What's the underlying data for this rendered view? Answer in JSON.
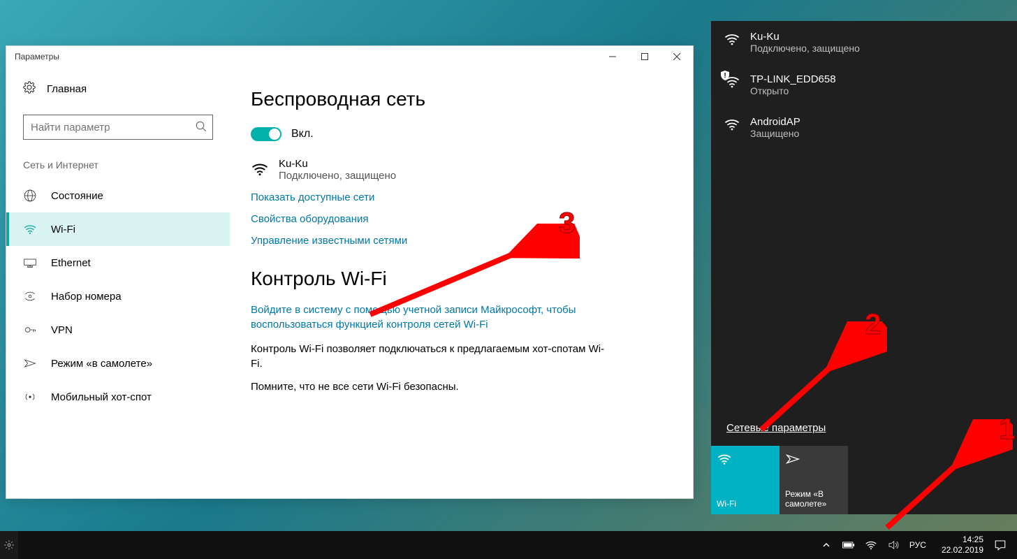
{
  "settings_window": {
    "title": "Параметры",
    "home": "Главная",
    "search_placeholder": "Найти параметр",
    "category": "Сеть и Интернет",
    "nav": [
      {
        "icon": "status",
        "label": "Состояние"
      },
      {
        "icon": "wifi",
        "label": "Wi-Fi"
      },
      {
        "icon": "ethernet",
        "label": "Ethernet"
      },
      {
        "icon": "dialup",
        "label": "Набор номера"
      },
      {
        "icon": "vpn",
        "label": "VPN"
      },
      {
        "icon": "airplane",
        "label": "Режим «в самолете»"
      },
      {
        "icon": "hotspot",
        "label": "Мобильный хот-спот"
      }
    ],
    "content": {
      "heading1": "Беспроводная сеть",
      "toggle_label": "Вкл.",
      "network": {
        "name": "Ku-Ku",
        "status": "Подключено, защищено"
      },
      "link_available": "Показать доступные сети",
      "link_hardware": "Свойства оборудования",
      "link_manage": "Управление известными сетями",
      "heading2": "Контроль Wi-Fi",
      "link_signin": "Войдите в систему с помощью учетной записи Майкрософт, чтобы воспользоваться функцией контроля сетей Wi-Fi",
      "p_control": "Контроль Wi-Fi позволяет подключаться к предлагаемым хот-спотам Wi-Fi.",
      "p_remember": "Помните, что не все сети Wi-Fi безопасны."
    }
  },
  "flyout": {
    "networks": [
      {
        "name": "Ku-Ku",
        "status": "Подключено, защищено",
        "secured": true,
        "warn": false
      },
      {
        "name": "TP-LINK_EDD658",
        "status": "Открыто",
        "secured": false,
        "warn": true
      },
      {
        "name": "AndroidAP",
        "status": "Защищено",
        "secured": true,
        "warn": false
      }
    ],
    "settings_link": "Сетевые параметры",
    "tiles": {
      "wifi": "Wi-Fi",
      "airplane": "Режим «В самолете»"
    }
  },
  "taskbar": {
    "lang": "РУС",
    "time": "14:25",
    "date": "22.02.2019"
  },
  "annotations": {
    "n1": "1",
    "n2": "2",
    "n3": "3"
  }
}
